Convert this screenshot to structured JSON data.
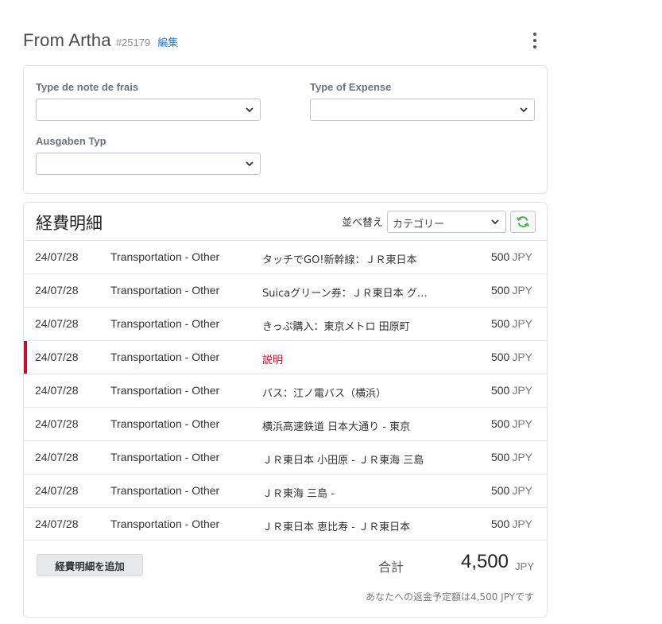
{
  "header": {
    "title": "From Artha",
    "report_id": "#25179",
    "edit_label": "編集",
    "menu_icon": "kebab-menu-icon"
  },
  "fields": [
    {
      "label": "Type de note de frais",
      "value": ""
    },
    {
      "label": "Type of Expense",
      "value": ""
    },
    {
      "label": "Ausgaben Typ",
      "value": ""
    }
  ],
  "list": {
    "title": "経費明細",
    "sort_label": "並べ替え",
    "sort_value": "カテゴリー",
    "refresh_icon": "refresh-icon",
    "rows": [
      {
        "date": "24/07/28",
        "category": "Transportation - Other",
        "description": "タッチでGO!新幹線：ＪＲ東日本",
        "amount": "500",
        "currency": "JPY",
        "flagged": false
      },
      {
        "date": "24/07/28",
        "category": "Transportation - Other",
        "description": "Suicaグリーン券：ＪＲ東日本 グリーン券",
        "amount": "500",
        "currency": "JPY",
        "flagged": false
      },
      {
        "date": "24/07/28",
        "category": "Transportation - Other",
        "description": "きっぷ購入：東京メトロ 田原町",
        "amount": "500",
        "currency": "JPY",
        "flagged": false
      },
      {
        "date": "24/07/28",
        "category": "Transportation - Other",
        "description": "説明",
        "amount": "500",
        "currency": "JPY",
        "flagged": true
      },
      {
        "date": "24/07/28",
        "category": "Transportation - Other",
        "description": "バス：江ノ電バス（横浜）",
        "amount": "500",
        "currency": "JPY",
        "flagged": false
      },
      {
        "date": "24/07/28",
        "category": "Transportation - Other",
        "description": "横浜高速鉄道 日本大通り - 東京",
        "amount": "500",
        "currency": "JPY",
        "flagged": false
      },
      {
        "date": "24/07/28",
        "category": "Transportation - Other",
        "description": "ＪＲ東日本 小田原 - ＪＲ東海 三島",
        "amount": "500",
        "currency": "JPY",
        "flagged": false
      },
      {
        "date": "24/07/28",
        "category": "Transportation - Other",
        "description": "ＪＲ東海 三島 -",
        "amount": "500",
        "currency": "JPY",
        "flagged": false
      },
      {
        "date": "24/07/28",
        "category": "Transportation - Other",
        "description": "ＪＲ東日本 恵比寿 - ＪＲ東日本",
        "amount": "500",
        "currency": "JPY",
        "flagged": false
      }
    ],
    "add_button_label": "経費明細を追加",
    "total_label": "合計",
    "total_value": "4,500",
    "total_currency": "JPY",
    "refund_note": "あなたへの返金予定額は4,500 JPYです"
  },
  "colors": {
    "accent_link": "#2a7ac6",
    "flag_red": "#c8102e",
    "refresh_green": "#4caf50"
  }
}
